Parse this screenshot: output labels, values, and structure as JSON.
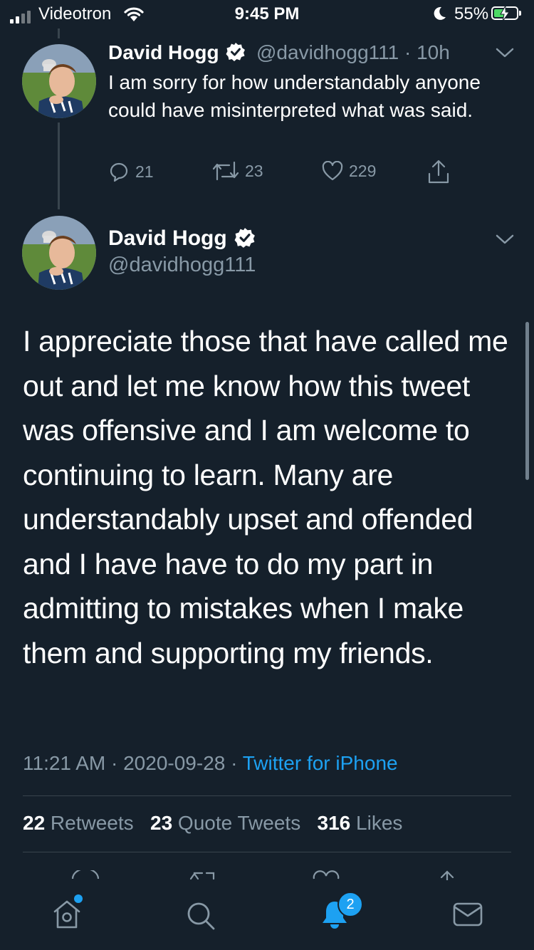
{
  "status_bar": {
    "carrier": "Videotron",
    "time": "9:45 PM",
    "battery_percent": "55%",
    "icons": [
      "signal-icon",
      "wifi-icon",
      "moon-icon",
      "battery-charging-icon"
    ]
  },
  "reply_tweet": {
    "name": "David Hogg",
    "verified": true,
    "handle_time": "@davidhogg111 · 10h",
    "text": "I am sorry for how understandably anyone could have misinterpreted what was said.",
    "actions": {
      "replies": "21",
      "retweets": "23",
      "likes": "229"
    }
  },
  "main_tweet": {
    "name": "David Hogg",
    "verified": true,
    "handle": "@davidhogg111",
    "text": "I appreciate those that have called me out and let me know how this tweet was offensive and I am welcome to continuing to learn. Many are understandably upset and offended and I have have to do my part in admitting to mistakes when I make them and supporting my friends.",
    "timestamp": "11:21 AM · 2020-09-28 · ",
    "source": "Twitter for iPhone",
    "stats": {
      "retweets_count": "22",
      "retweets_label": " Retweets",
      "quotes_count": "23",
      "quotes_label": " Quote Tweets",
      "likes_count": "316",
      "likes_label": " Likes"
    }
  },
  "tab_bar": {
    "notifications_badge": "2",
    "accent_color": "#1da1f2"
  }
}
